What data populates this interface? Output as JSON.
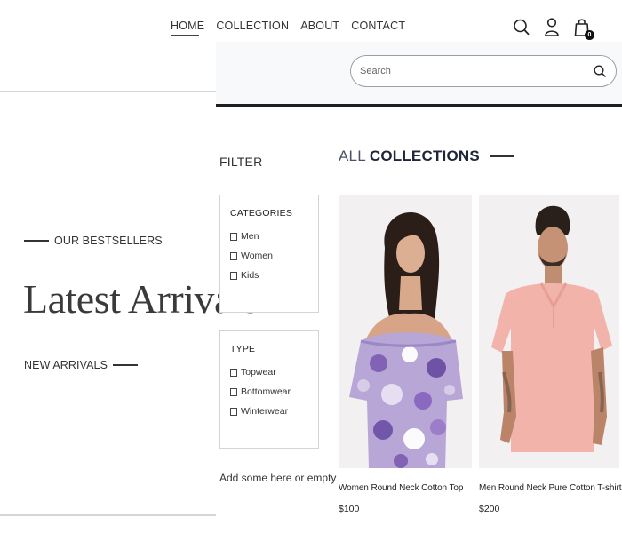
{
  "nav": {
    "links": [
      {
        "label": "HOME",
        "active": true
      },
      {
        "label": "COLLECTION",
        "active": false
      },
      {
        "label": "ABOUT",
        "active": false
      },
      {
        "label": "CONTACT",
        "active": false
      }
    ],
    "icons": [
      "search-icon",
      "profile-icon",
      "cart-icon"
    ],
    "cart_count": "0"
  },
  "hero": {
    "eyebrow": "OUR BESTSELLERS",
    "title": "Latest Arrivals",
    "cta": "NEW ARRIVALS"
  },
  "search": {
    "placeholder": "Search",
    "value": ""
  },
  "filter": {
    "title": "FILTER",
    "categories": {
      "heading": "CATEGORIES",
      "options": [
        "Men",
        "Women",
        "Kids"
      ]
    },
    "type": {
      "heading": "TYPE",
      "options": [
        "Topwear",
        "Bottomwear",
        "Winterwear"
      ]
    },
    "note": "Add some here or empty"
  },
  "collections": {
    "heading_pre": "ALL",
    "heading_main": "COLLECTIONS",
    "products": [
      {
        "name": "Women Round Neck Cotton Top",
        "price": "$100",
        "image_icon": "product-image-women-floral-top"
      },
      {
        "name": "Men Round Neck Pure Cotton T-shirt",
        "price": "$200",
        "image_icon": "product-image-men-pink-shirt"
      }
    ]
  },
  "colors": {
    "accent_dark": "#1e2638",
    "panel_bg": "#f8f9fb",
    "divider": "#d6d6d6"
  }
}
